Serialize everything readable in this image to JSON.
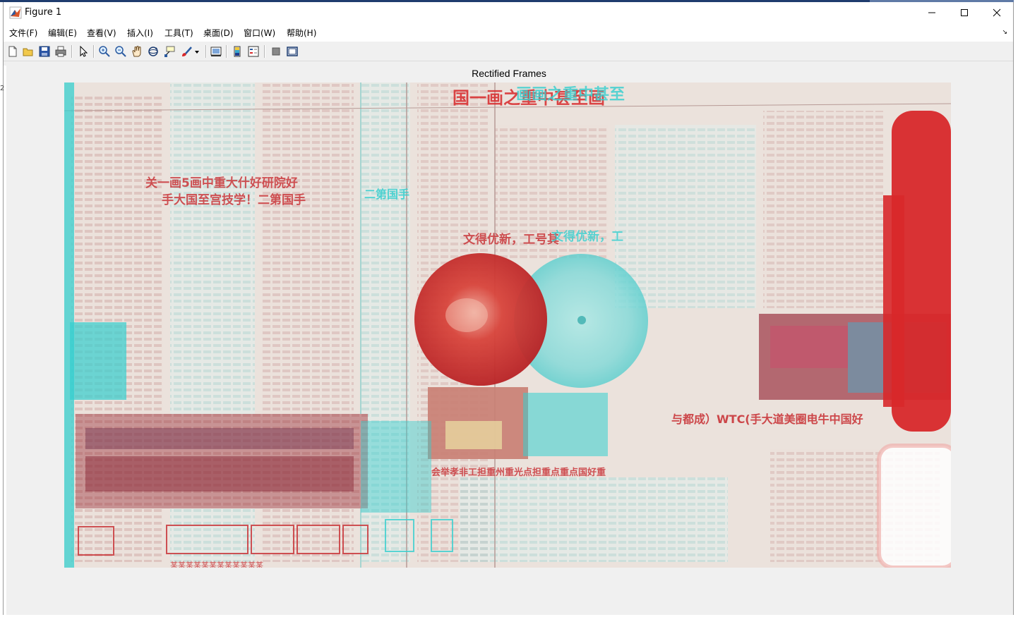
{
  "window": {
    "title": "Figure 1",
    "minimize_glyph": "—",
    "maximize_glyph": "☐",
    "close_glyph": "✕"
  },
  "menu": [
    "文件(F)",
    "编辑(E)",
    "查看(V)",
    "插入(I)",
    "工具(T)",
    "桌面(D)",
    "窗口(W)",
    "帮助(H)"
  ],
  "toolbar": {
    "icons": [
      "new-figure-icon",
      "open-file-icon",
      "save-icon",
      "print-icon",
      "pointer-icon",
      "zoom-in-icon",
      "zoom-out-icon",
      "pan-hand-icon",
      "rotate-3d-icon",
      "data-cursor-icon",
      "brush-icon",
      "brush-dropdown-icon",
      "link-plot-icon",
      "colorbar-icon",
      "legend-icon",
      "hide-plot-tools-icon",
      "show-plot-tools-icon"
    ]
  },
  "figure": {
    "title": "Rectified Frames",
    "image": {
      "colors": {
        "red": "#d8282a",
        "cyan": "#35cfcf",
        "paper": "#eae2dc"
      },
      "headline_upper": "国一画之重中甚至画",
      "headline_left_1": "关一画5画中重大什好研院好",
      "headline_left_2": "手大国至宫技学！二第国手",
      "headline_center": "文得优新，工号其",
      "caption_right": "与都成）WTC(手大道美圈电牛中国好",
      "caption_bottom": "会举孝非工担重州重光点担重点重点国好重",
      "bottom_line": "某某某某某某某某某某某某"
    }
  }
}
